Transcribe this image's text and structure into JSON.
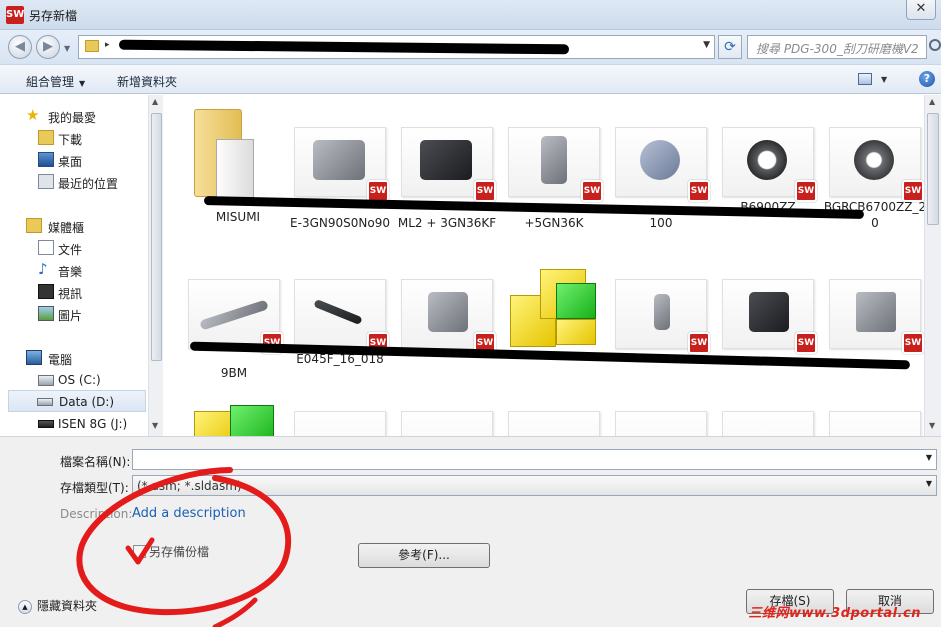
{
  "window": {
    "title": "另存新檔",
    "app_badge": "SW",
    "close_glyph": "✕"
  },
  "address": {
    "redacted": true,
    "path_arrow": "▸",
    "search_placeholder": "搜尋 PDG-300_刮刀研磨機V2"
  },
  "toolbar": {
    "organize": "組合管理",
    "new_folder": "新增資料夾",
    "help": "?"
  },
  "sidebar": {
    "items": [
      {
        "label": "我的最愛",
        "icon": "star-icon"
      },
      {
        "label": "下載",
        "icon": "download-folder-icon"
      },
      {
        "label": "桌面",
        "icon": "desktop-icon"
      },
      {
        "label": "最近的位置",
        "icon": "recent-places-icon"
      },
      {
        "label": "媒體櫃",
        "icon": "library-icon"
      },
      {
        "label": "文件",
        "icon": "documents-icon"
      },
      {
        "label": "音樂",
        "icon": "music-icon"
      },
      {
        "label": "視訊",
        "icon": "video-icon"
      },
      {
        "label": "圖片",
        "icon": "pictures-icon"
      },
      {
        "label": "電腦",
        "icon": "computer-icon"
      },
      {
        "label": "OS (C:)",
        "icon": "drive-icon"
      },
      {
        "label": "Data (D:)",
        "icon": "drive-icon",
        "selected": true
      },
      {
        "label": "ISEN 8G (J:)",
        "icon": "usb-drive-icon"
      }
    ]
  },
  "files": {
    "row1": [
      {
        "name": "MISUMI",
        "kind": "folder"
      },
      {
        "name": "E-3GN90S0No90",
        "kind": "part"
      },
      {
        "name": "ML2 + 3GN36KF",
        "kind": "part"
      },
      {
        "name": "+5GN36K",
        "kind": "part"
      },
      {
        "name": "100",
        "kind": "part"
      },
      {
        "name": "B6900ZZ",
        "kind": "part"
      },
      {
        "name": "BGRCB6700ZZ_20",
        "kind": "part"
      }
    ],
    "row2": [
      {
        "name": "9BM",
        "kind": "part"
      },
      {
        "name": "E045F_16_018",
        "kind": "part"
      },
      {
        "name": "",
        "kind": "part"
      },
      {
        "name": "",
        "kind": "assembly"
      },
      {
        "name": "",
        "kind": "part"
      },
      {
        "name": "",
        "kind": "part"
      },
      {
        "name": "",
        "kind": "part"
      }
    ],
    "sw_badge": "SW"
  },
  "form": {
    "filename_label": "檔案名稱(N):",
    "filename_value": "",
    "type_label": "存檔類型(T):",
    "type_value": "(*.asm; *.sldasm)",
    "description_label": "Description:",
    "description_link": "Add a description",
    "backup_label": "另存備份檔",
    "browse_button": "參考(F)...",
    "save_button": "存檔(S)",
    "cancel_button": "取消",
    "hide_folders": "隱藏資料夾"
  },
  "watermark": "三维网www.3dportal.cn"
}
